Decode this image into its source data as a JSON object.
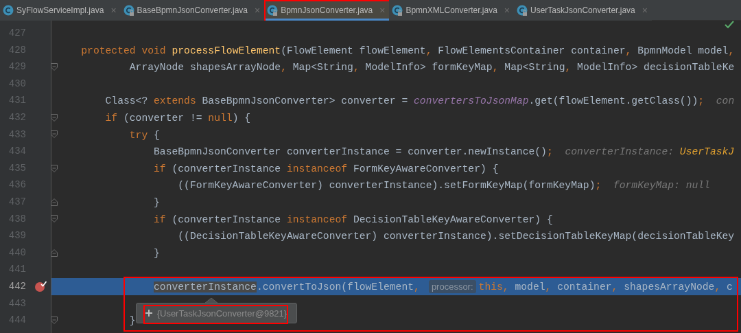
{
  "tabs": [
    {
      "label": "SyFlowServiceImpl.java",
      "close": "×",
      "selected": false,
      "locked": false,
      "framed": false
    },
    {
      "label": "BaseBpmnJsonConverter.java",
      "close": "×",
      "selected": false,
      "locked": true,
      "framed": false
    },
    {
      "label": "BpmnJsonConverter.java",
      "close": "×",
      "selected": true,
      "locked": true,
      "framed": true
    },
    {
      "label": "BpmnXMLConverter.java",
      "close": "×",
      "selected": false,
      "locked": true,
      "framed": false
    },
    {
      "label": "UserTaskJsonConverter.java",
      "close": "×",
      "selected": false,
      "locked": true,
      "framed": false
    }
  ],
  "editor": {
    "lines": [
      {
        "number": "427",
        "kind": "code",
        "current": false,
        "breakpoint": false,
        "framed": false
      },
      {
        "number": "428",
        "kind": "code",
        "current": false,
        "breakpoint": false,
        "framed": false,
        "segments": [
          {
            "kind": "keyword",
            "text": "    protected"
          },
          {
            "kind": "keyword",
            "text": " void"
          },
          {
            "kind": "method",
            "text": " processFlowElement"
          },
          {
            "kind": "plain",
            "text": "(FlowElement flowElement"
          },
          {
            "kind": "punct",
            "text": ","
          },
          {
            "kind": "plain",
            "text": " FlowElementsContainer container"
          },
          {
            "kind": "punct",
            "text": ","
          },
          {
            "kind": "plain",
            "text": " BpmnModel model"
          },
          {
            "kind": "punct",
            "text": ","
          }
        ]
      },
      {
        "number": "429",
        "kind": "fold-start",
        "current": false,
        "breakpoint": false,
        "framed": false,
        "segments": [
          {
            "kind": "plain",
            "text": "            ArrayNode shapesArrayNode"
          },
          {
            "kind": "punct",
            "text": ","
          },
          {
            "kind": "plain",
            "text": " Map<String"
          },
          {
            "kind": "punct",
            "text": ","
          },
          {
            "kind": "plain",
            "text": " ModelInfo> formKeyMap"
          },
          {
            "kind": "punct",
            "text": ","
          },
          {
            "kind": "plain",
            "text": " Map<String"
          },
          {
            "kind": "punct",
            "text": ","
          },
          {
            "kind": "plain",
            "text": " ModelInfo> decisionTableKe"
          }
        ]
      },
      {
        "number": "430",
        "kind": "code",
        "current": false,
        "breakpoint": false,
        "framed": false
      },
      {
        "number": "431",
        "kind": "code",
        "current": false,
        "breakpoint": false,
        "framed": false,
        "segments": [
          {
            "kind": "plain",
            "text": "        Class<?"
          },
          {
            "kind": "keyword",
            "text": " extends"
          },
          {
            "kind": "plain",
            "text": " BaseBpmnJsonConverter> converter ="
          },
          {
            "kind": "field",
            "text": " convertersToJsonMap"
          },
          {
            "kind": "plain",
            "text": ".get(flowElement.getClass())"
          },
          {
            "kind": "punct",
            "text": ";"
          },
          {
            "kind": "hint",
            "text": "  con"
          }
        ]
      },
      {
        "number": "432",
        "kind": "fold-start",
        "current": false,
        "breakpoint": false,
        "framed": false,
        "segments": [
          {
            "kind": "keyword",
            "text": "        if"
          },
          {
            "kind": "plain",
            "text": " (converter !="
          },
          {
            "kind": "keyword",
            "text": " null"
          },
          {
            "kind": "plain",
            "text": ") {"
          }
        ]
      },
      {
        "number": "433",
        "kind": "fold-start",
        "current": false,
        "breakpoint": false,
        "framed": false,
        "segments": [
          {
            "kind": "keyword",
            "text": "            try"
          },
          {
            "kind": "plain",
            "text": " {"
          }
        ]
      },
      {
        "number": "434",
        "kind": "code",
        "current": false,
        "breakpoint": false,
        "framed": false,
        "segments": [
          {
            "kind": "plain",
            "text": "                BaseBpmnJsonConverter converterInstance = converter.newInstance()"
          },
          {
            "kind": "punct",
            "text": ";"
          },
          {
            "kind": "hint",
            "text": "  converterInstance:"
          },
          {
            "kind": "hintvalue",
            "text": " UserTaskJ"
          }
        ]
      },
      {
        "number": "435",
        "kind": "fold-start",
        "current": false,
        "breakpoint": false,
        "framed": false,
        "segments": [
          {
            "kind": "keyword",
            "text": "                if"
          },
          {
            "kind": "plain",
            "text": " (converterInstance"
          },
          {
            "kind": "keyword",
            "text": " instanceof"
          },
          {
            "kind": "plain",
            "text": " FormKeyAwareConverter) {"
          }
        ]
      },
      {
        "number": "436",
        "kind": "code",
        "current": false,
        "breakpoint": false,
        "framed": false,
        "segments": [
          {
            "kind": "plain",
            "text": "                    ((FormKeyAwareConverter) converterInstance).setFormKeyMap(formKeyMap)"
          },
          {
            "kind": "punct",
            "text": ";"
          },
          {
            "kind": "hint",
            "text": "  formKeyMap: null"
          }
        ]
      },
      {
        "number": "437",
        "kind": "fold-end",
        "current": false,
        "breakpoint": false,
        "framed": false,
        "segments": [
          {
            "kind": "plain",
            "text": "                }"
          }
        ]
      },
      {
        "number": "438",
        "kind": "fold-start",
        "current": false,
        "breakpoint": false,
        "framed": false,
        "segments": [
          {
            "kind": "keyword",
            "text": "                if"
          },
          {
            "kind": "plain",
            "text": " (converterInstance"
          },
          {
            "kind": "keyword",
            "text": " instanceof"
          },
          {
            "kind": "plain",
            "text": " DecisionTableKeyAwareConverter) {"
          }
        ]
      },
      {
        "number": "439",
        "kind": "code",
        "current": false,
        "breakpoint": false,
        "framed": false,
        "segments": [
          {
            "kind": "plain",
            "text": "                    ((DecisionTableKeyAwareConverter) converterInstance).setDecisionTableKeyMap(decisionTableKey"
          }
        ]
      },
      {
        "number": "440",
        "kind": "fold-end",
        "current": false,
        "breakpoint": false,
        "framed": false,
        "segments": [
          {
            "kind": "plain",
            "text": "                }"
          }
        ]
      },
      {
        "number": "441",
        "kind": "code",
        "current": false,
        "breakpoint": false,
        "framed": false
      },
      {
        "number": "442",
        "kind": "code",
        "current": true,
        "breakpoint": true,
        "framed": true,
        "segments": [
          {
            "kind": "selected",
            "text": "                converterInstance"
          },
          {
            "kind": "plain",
            "text": ".convertToJson(flowElement"
          },
          {
            "kind": "punct",
            "text": ","
          },
          {
            "kind": "inlay",
            "text": "processor:"
          },
          {
            "kind": "keyword",
            "text": "this"
          },
          {
            "kind": "punct",
            "text": ","
          },
          {
            "kind": "plain",
            "text": " model"
          },
          {
            "kind": "punct",
            "text": ","
          },
          {
            "kind": "plain",
            "text": " container"
          },
          {
            "kind": "punct",
            "text": ","
          },
          {
            "kind": "plain",
            "text": " shapesArrayNode"
          },
          {
            "kind": "punct",
            "text": ","
          },
          {
            "kind": "plain",
            "text": " c"
          }
        ]
      },
      {
        "number": "443",
        "kind": "code",
        "current": false,
        "breakpoint": false,
        "framed": false
      },
      {
        "number": "444",
        "kind": "fold-start",
        "current": false,
        "breakpoint": false,
        "framed": false,
        "segments": [
          {
            "kind": "plain",
            "text": "            }"
          }
        ]
      }
    ],
    "tooltip": {
      "value": "{UserTaskJsonConverter@9821}",
      "framed": true
    }
  }
}
